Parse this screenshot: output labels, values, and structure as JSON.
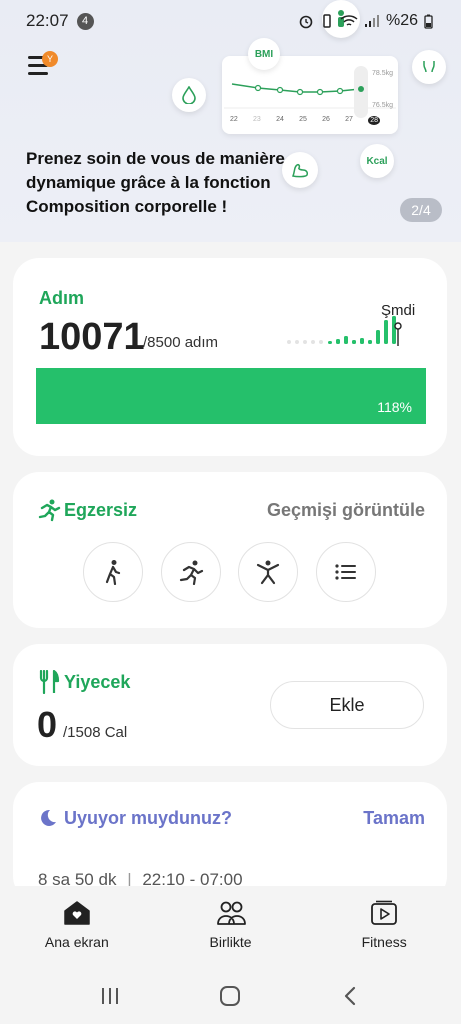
{
  "status_bar": {
    "time": "22:07",
    "notification_count": "4",
    "battery": "%26"
  },
  "banner": {
    "menu_badge": "Y",
    "text": "Prenez soin de vous de manière dynamique grâce à la fonction Composition corporelle !",
    "counter": "2/4",
    "illustration": {
      "bmi_label": "BMI",
      "kcal_label": "Kcal",
      "weight_high": "78.5kg",
      "weight_low": "76.5kg",
      "days": [
        "22",
        "23",
        "24",
        "25",
        "26",
        "27",
        "28"
      ]
    }
  },
  "steps": {
    "title": "Adım",
    "value": "10071",
    "goal": "/8500 adım",
    "now_label": "Şmdi",
    "percent_label": "118%",
    "progress_fraction": 1.0
  },
  "exercise": {
    "title": "Egzersiz",
    "history_link": "Geçmişi görüntüle",
    "buttons": [
      "walking-icon",
      "running-icon",
      "workout-icon",
      "list-icon"
    ]
  },
  "food": {
    "title": "Yiyecek",
    "value": "0",
    "goal": "/1508 Cal",
    "add_label": "Ekle"
  },
  "sleep": {
    "title": "Uyuyor muydunuz?",
    "ok_label": "Tamam",
    "duration": "8 sa 50 dk",
    "range": "22:10 - 07:00"
  },
  "bottom_nav": {
    "home": "Ana ekran",
    "together": "Birlikte",
    "fitness": "Fitness"
  },
  "colors": {
    "accent_green": "#25c06b",
    "title_green": "#1fa65a",
    "sleep_purple": "#6b74c9"
  }
}
